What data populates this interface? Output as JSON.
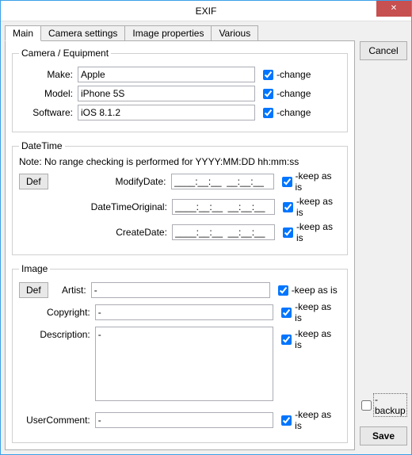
{
  "window": {
    "title": "EXIF"
  },
  "tabs": {
    "main": "Main",
    "camera": "Camera settings",
    "image": "Image properties",
    "various": "Various"
  },
  "equip": {
    "legend": "Camera / Equipment",
    "make_label": "Make:",
    "make_value": "Apple",
    "make_change": "-change",
    "model_label": "Model:",
    "model_value": "iPhone 5S",
    "model_change": "-change",
    "soft_label": "Software:",
    "soft_value": "iOS 8.1.2",
    "soft_change": "-change"
  },
  "datetime": {
    "legend": "DateTime",
    "note": "Note: No range checking is performed for YYYY:MM:DD hh:mm:ss",
    "def": "Def",
    "modify_label": "ModifyDate:",
    "modify_keep": "-keep as is",
    "orig_label": "DateTimeOriginal:",
    "orig_keep": "-keep as is",
    "create_label": "CreateDate:",
    "create_keep": "-keep as is",
    "mask": "____:__:__  __:__:__"
  },
  "image": {
    "legend": "Image",
    "def": "Def",
    "artist_label": "Artist:",
    "artist_value": "-",
    "artist_keep": "-keep as is",
    "copyright_label": "Copyright:",
    "copyright_value": "-",
    "copyright_keep": "-keep as is",
    "desc_label": "Description:",
    "desc_value": "-",
    "desc_keep": "-keep as is",
    "comment_label": "UserComment:",
    "comment_value": "-",
    "comment_keep": "-keep as is"
  },
  "side": {
    "cancel": "Cancel",
    "backup": "-backup",
    "save": "Save"
  }
}
